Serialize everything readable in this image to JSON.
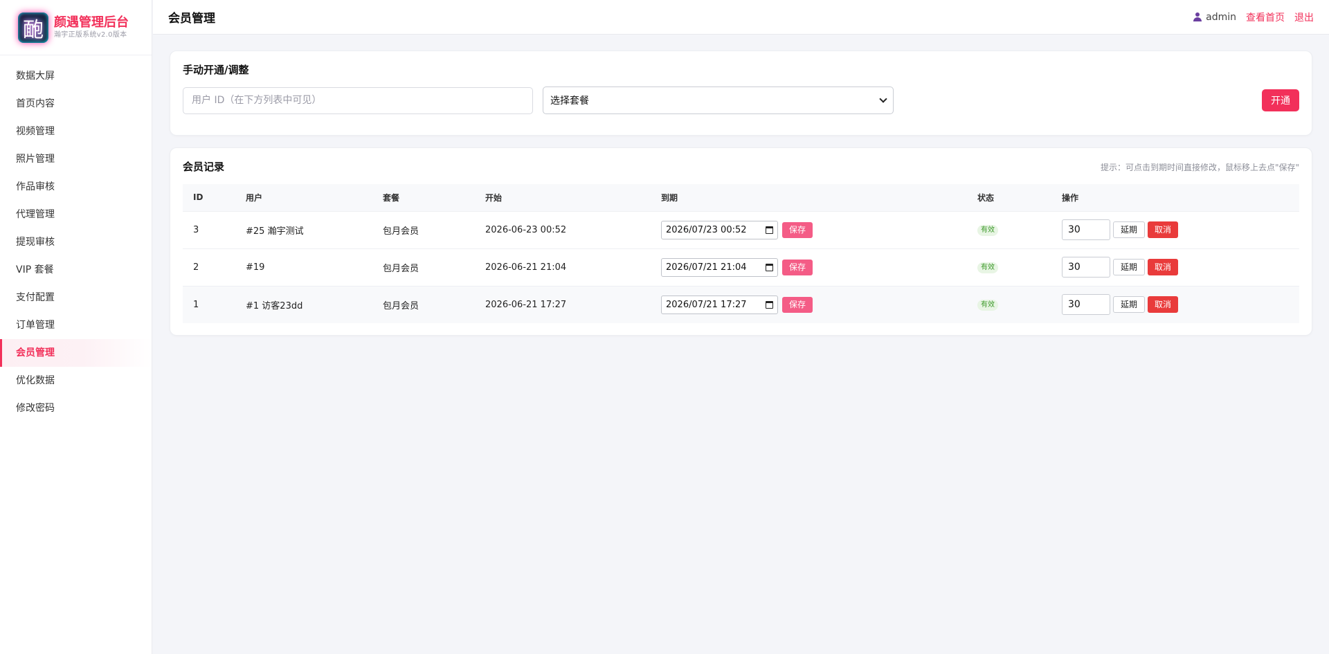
{
  "brand": {
    "title": "颜遇管理后台",
    "subtitle": "瀚宇正版系统v2.0版本"
  },
  "sidebar": {
    "items": [
      {
        "label": "数据大屏"
      },
      {
        "label": "首页内容"
      },
      {
        "label": "视频管理"
      },
      {
        "label": "照片管理"
      },
      {
        "label": "作品审核"
      },
      {
        "label": "代理管理"
      },
      {
        "label": "提现审核"
      },
      {
        "label": "VIP 套餐"
      },
      {
        "label": "支付配置"
      },
      {
        "label": "订单管理"
      },
      {
        "label": "会员管理",
        "active": true
      },
      {
        "label": "优化数据"
      },
      {
        "label": "修改密码"
      }
    ]
  },
  "header": {
    "title": "会员管理",
    "username": "admin",
    "home_link": "查看首页",
    "logout_link": "退出"
  },
  "manual": {
    "title": "手动开通/调整",
    "uid_placeholder": "用户 ID（在下方列表中可见）",
    "select_value": "选择套餐",
    "submit_label": "开通"
  },
  "records": {
    "title": "会员记录",
    "tip": "提示：可点击到期时间直接修改，鼠标移上去点\"保存\"",
    "columns": [
      "ID",
      "用户",
      "套餐",
      "开始",
      "到期",
      "状态",
      "操作"
    ],
    "rows": [
      {
        "id": "3",
        "user": "#25 瀚宇测试",
        "plan": "包月会员",
        "start": "2026-06-23 00:52",
        "expire": "2026/07/23 00:52",
        "status": "有效",
        "days": "30"
      },
      {
        "id": "2",
        "user": "#19",
        "plan": "包月会员",
        "start": "2026-06-21 21:04",
        "expire": "2026/07/21 21:04",
        "status": "有效",
        "days": "30"
      },
      {
        "id": "1",
        "user": "#1 访客23dd",
        "plan": "包月会员",
        "start": "2026-06-21 17:27",
        "expire": "2026/07/21 17:27",
        "status": "有效",
        "days": "30"
      }
    ],
    "save_label": "保存",
    "extend_label": "延期",
    "cancel_label": "取消"
  }
}
